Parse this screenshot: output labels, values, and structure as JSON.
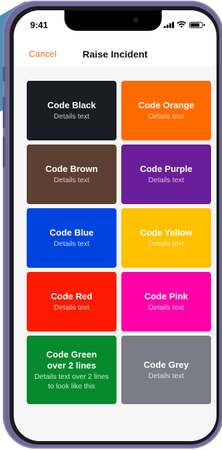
{
  "status_bar": {
    "time": "9:41",
    "icons": [
      "signal-icon",
      "wifi-icon",
      "battery-icon"
    ]
  },
  "nav": {
    "cancel_label": "Cancel",
    "title": "Raise Incident",
    "accent_color": "#f26b1d"
  },
  "tiles": [
    {
      "title": "Code Black",
      "detail": "Details text",
      "bg": "#1b1c24",
      "title_color": "#ffffff",
      "detail_color": "#c8c8cc"
    },
    {
      "title": "Code Orange",
      "detail": "Details text",
      "bg": "#ff6a00",
      "title_color": "#ffffff",
      "detail_color": "#ffd3b3"
    },
    {
      "title": "Code Brown",
      "detail": "Details text",
      "bg": "#5c4034",
      "title_color": "#ffffff",
      "detail_color": "#d9cbc4"
    },
    {
      "title": "Code Purple",
      "detail": "Details text",
      "bg": "#6a1e9a",
      "title_color": "#ffffff",
      "detail_color": "#d8c4e6"
    },
    {
      "title": "Code Blue",
      "detail": "Details text",
      "bg": "#0044e0",
      "title_color": "#ffffff",
      "detail_color": "#c9d7ff"
    },
    {
      "title": "Code Yellow",
      "detail": "Details text",
      "bg": "#ffc000",
      "title_color": "#ffffff",
      "detail_color": "#fff0c0"
    },
    {
      "title": "Code Red",
      "detail": "Details text",
      "bg": "#fe1a00",
      "title_color": "#ffffff",
      "detail_color": "#ffd0c9"
    },
    {
      "title": "Code Pink",
      "detail": "Details text",
      "bg": "#ff00a8",
      "title_color": "#ffffff",
      "detail_color": "#ffc7ec"
    },
    {
      "title": "Code Green over 2 lines",
      "detail": "Details text over 2 lines to look like this",
      "bg": "#078a2e",
      "title_color": "#ffffff",
      "detail_color": "#ccead4"
    },
    {
      "title": "Code Grey",
      "detail": "Details text",
      "bg": "#7b7c86",
      "title_color": "#ffffff",
      "detail_color": "#e2e2e6"
    }
  ]
}
